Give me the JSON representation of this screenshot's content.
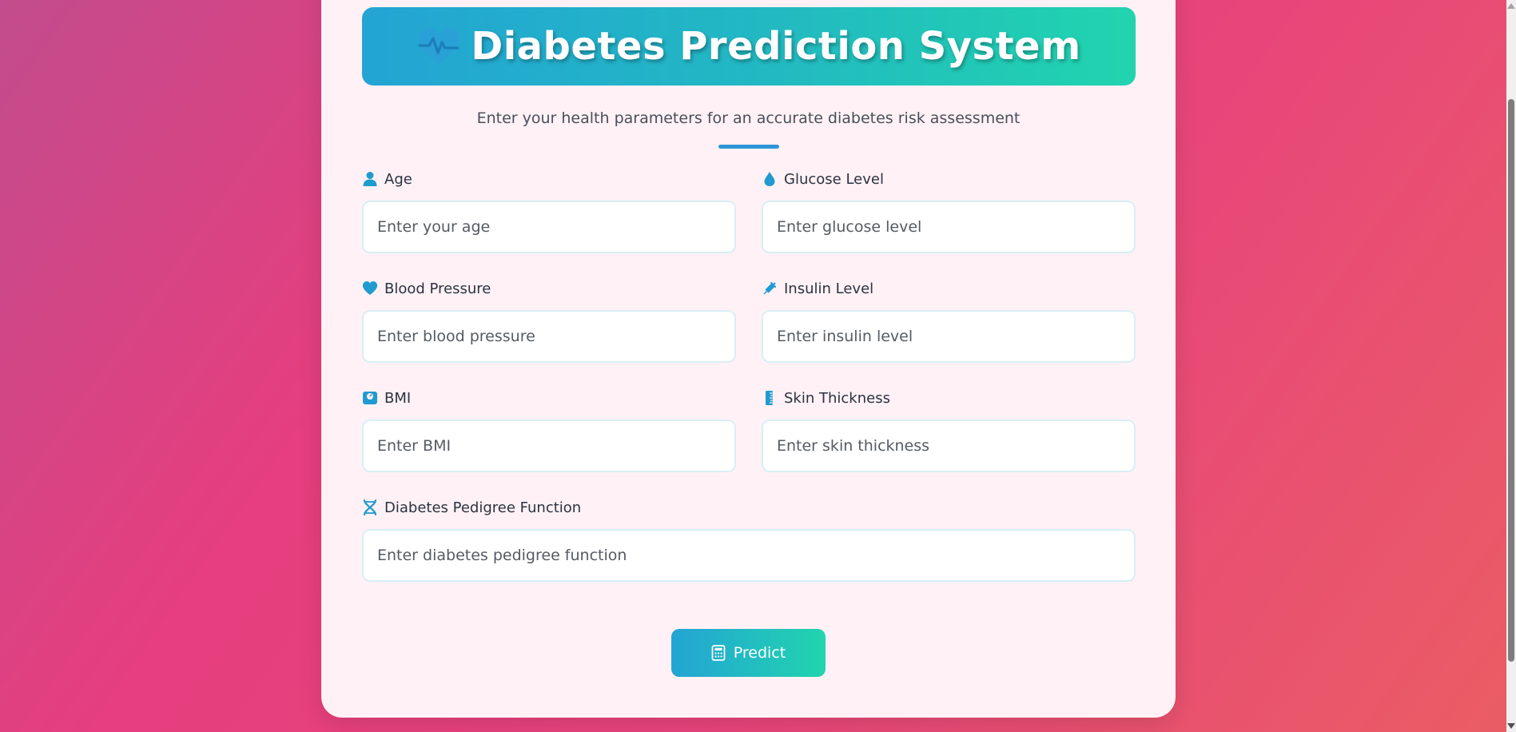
{
  "header": {
    "title": "Diabetes Prediction System",
    "icon": "heart-pulse-icon"
  },
  "subtitle": "Enter your health parameters for an accurate diabetes risk assessment",
  "form": {
    "age": {
      "label": "Age",
      "placeholder": "Enter your age",
      "value": "",
      "icon": "user-icon"
    },
    "glucose": {
      "label": "Glucose Level",
      "placeholder": "Enter glucose level",
      "value": "",
      "icon": "droplet-icon"
    },
    "blood_pressure": {
      "label": "Blood Pressure",
      "placeholder": "Enter blood pressure",
      "value": "",
      "icon": "heart-icon"
    },
    "insulin": {
      "label": "Insulin Level",
      "placeholder": "Enter insulin level",
      "value": "",
      "icon": "syringe-icon"
    },
    "bmi": {
      "label": "BMI",
      "placeholder": "Enter BMI",
      "value": "",
      "icon": "weight-scale-icon"
    },
    "skin_thickness": {
      "label": "Skin Thickness",
      "placeholder": "Enter skin thickness",
      "value": "",
      "icon": "ruler-icon"
    },
    "pedigree": {
      "label": "Diabetes Pedigree Function",
      "placeholder": "Enter diabetes pedigree function",
      "value": "",
      "icon": "dna-icon"
    }
  },
  "predict_button": {
    "label": "Predict",
    "icon": "calculator-icon"
  },
  "colors": {
    "accent": "#23a4d4",
    "accent_end": "#21d4ae",
    "card_background": "#fff1f5",
    "page_gradient_start": "#c24c8d",
    "page_gradient_end": "#ea5d64"
  }
}
